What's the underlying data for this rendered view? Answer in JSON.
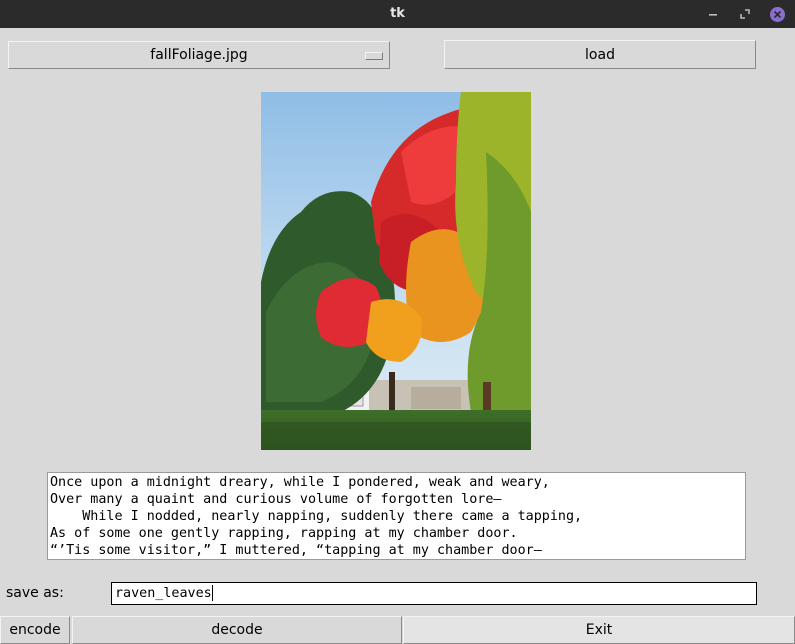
{
  "window": {
    "title": "tk"
  },
  "file_menu": {
    "selected": "fallFoliage.jpg"
  },
  "buttons": {
    "load": "load",
    "encode": "encode",
    "decode": "decode",
    "exit": "Exit"
  },
  "poem": {
    "lines": [
      "Once upon a midnight dreary, while I pondered, weak and weary,",
      "Over many a quaint and curious volume of forgotten lore—",
      "    While I nodded, nearly napping, suddenly there came a tapping,",
      "As of some one gently rapping, rapping at my chamber door.",
      "“’Tis some visitor,” I muttered, “tapping at my chamber door—"
    ]
  },
  "save_as": {
    "label": "save as:",
    "value": "raven_leaves"
  },
  "colors": {
    "background": "#d9d9d9",
    "titlebar": "#2b2b2b",
    "close_button": "#8b6fd0"
  }
}
